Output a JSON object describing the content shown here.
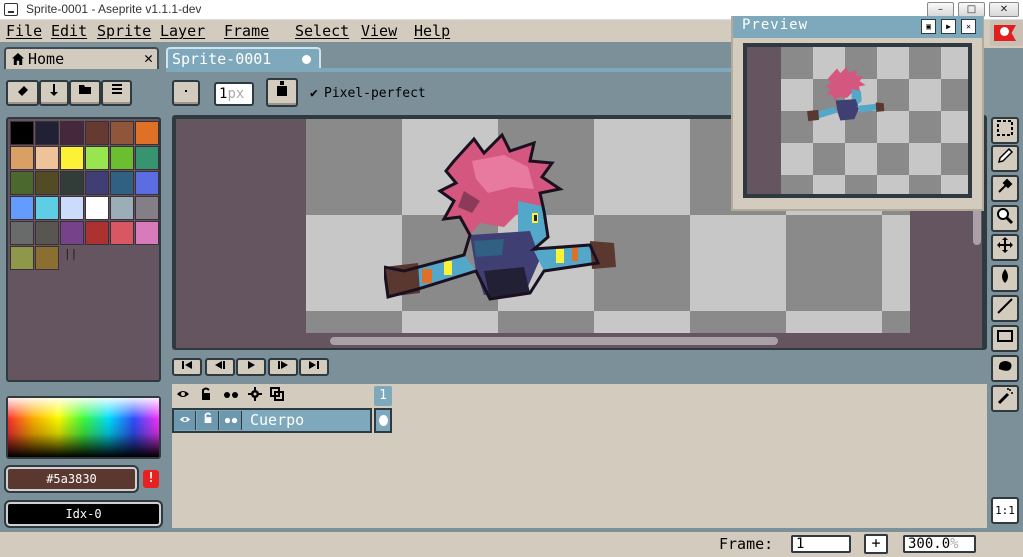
{
  "window": {
    "title": "Sprite-0001 - Aseprite v1.1.1-dev",
    "controls": [
      "–",
      "□",
      "✕"
    ]
  },
  "menubar": {
    "items": [
      "File",
      "Edit",
      "Sprite",
      "Layer",
      "Frame",
      "Select",
      "View",
      "Help"
    ]
  },
  "tabs": {
    "home": {
      "label": "Home",
      "close": "✕"
    },
    "sprite": {
      "label": "Sprite-0001"
    }
  },
  "toolbar": {
    "brush_size": "1",
    "brush_unit": "px",
    "pixel_perfect_label": "Pixel-perfect",
    "pixel_perfect_checked": true
  },
  "palette": {
    "colors": [
      "#000000",
      "#222034",
      "#45283c",
      "#663931",
      "#8f563b",
      "#df7126",
      "#d9a066",
      "#eec39a",
      "#fbf236",
      "#99e550",
      "#6abe30",
      "#37946e",
      "#4b692f",
      "#524b24",
      "#323c39",
      "#3f3f74",
      "#306082",
      "#5b6ee1",
      "#639bff",
      "#5fcde4",
      "#cbdbfc",
      "#ffffff",
      "#9badb7",
      "#847e87",
      "#696a6a",
      "#595652",
      "#76428a",
      "#ac3232",
      "#d95763",
      "#d77bba",
      "#8f974a",
      "#8a6f30"
    ],
    "resize_handle": "||"
  },
  "colors": {
    "foreground_label": "#5a3830",
    "foreground_value": "#5a3830",
    "warning": "!",
    "background_label": "Idx-0"
  },
  "playback": {
    "buttons": [
      "⏮",
      "◀◀",
      "▶",
      "▶▶",
      "⏭"
    ]
  },
  "timeline": {
    "header_icons": [
      "👁",
      "🔓",
      "●●",
      "⚙",
      "⧉"
    ],
    "frames": [
      "1"
    ],
    "layers": [
      {
        "name": "Cuerpo",
        "visible_icon": "👁",
        "lock_icon": "🔓",
        "continuous_icon": "●●"
      }
    ]
  },
  "preview": {
    "title": "Preview",
    "buttons": [
      "▣",
      "▶",
      "✕"
    ]
  },
  "status": {
    "frame_label": "Frame:",
    "frame_value": "1",
    "add_frame": "+",
    "zoom_value": "300.0",
    "zoom_unit": "%"
  },
  "right_tools": [
    "rectangular-marquee",
    "pencil",
    "eyedropper",
    "zoom",
    "move",
    "paint-bucket",
    "line",
    "rectangle",
    "contour",
    "spray"
  ],
  "ratio_label": "1:1"
}
